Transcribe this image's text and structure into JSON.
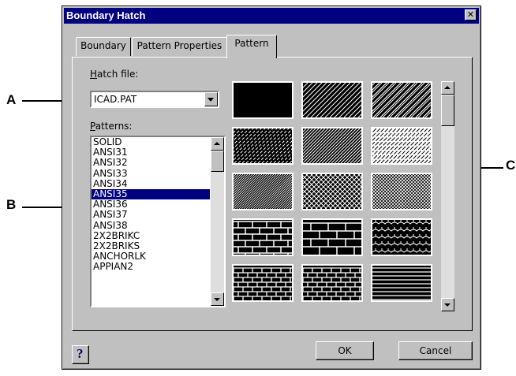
{
  "window": {
    "title": "Boundary Hatch",
    "close_glyph": "✕"
  },
  "tabs": [
    {
      "label": "Boundary",
      "active": false
    },
    {
      "label": "Pattern Properties",
      "active": false
    },
    {
      "label": "Pattern",
      "active": true
    }
  ],
  "hatch_file": {
    "label_prefix": "H",
    "label_rest": "atch file:",
    "value": "ICAD.PAT"
  },
  "patterns": {
    "label_prefix": "P",
    "label_rest": "atterns:",
    "items": [
      "SOLID",
      "ANSI31",
      "ANSI32",
      "ANSI33",
      "ANSI34",
      "ANSI35",
      "ANSI36",
      "ANSI37",
      "ANSI38",
      "2X2BRIKC",
      "2X2BRIKS",
      "ANCHORLK",
      "APPIAN2"
    ],
    "selected": "ANSI35"
  },
  "swatches": [
    {
      "name": "solid-swatch",
      "kind": "solid"
    },
    {
      "name": "ansi31-swatch",
      "kind": "diag-sparse"
    },
    {
      "name": "ansi32-swatch",
      "kind": "diag-double"
    },
    {
      "name": "ansi33-swatch",
      "kind": "diag-dash"
    },
    {
      "name": "ansi34-swatch",
      "kind": "diag-dense"
    },
    {
      "name": "ansi35-swatch",
      "kind": "diag-light"
    },
    {
      "name": "ansi36-swatch",
      "kind": "diag-fine"
    },
    {
      "name": "ansi37-swatch",
      "kind": "crosshatch"
    },
    {
      "name": "ansi38-swatch",
      "kind": "crosshatch-dense"
    },
    {
      "name": "2x2brikc-swatch",
      "kind": "brick-a"
    },
    {
      "name": "2x2briks-swatch",
      "kind": "brick-b"
    },
    {
      "name": "anchorlk-swatch",
      "kind": "wave"
    },
    {
      "name": "appian2-swatch",
      "kind": "brick-row"
    },
    {
      "name": "brick2-swatch",
      "kind": "brick-row"
    },
    {
      "name": "lines-swatch",
      "kind": "hlines"
    }
  ],
  "callouts": [
    "A",
    "B",
    "C"
  ],
  "buttons": {
    "ok": "OK",
    "cancel": "Cancel",
    "help": "?"
  },
  "colors": {
    "titlebar": "#000080",
    "face": "#c0c0c0",
    "selection": "#000080"
  }
}
